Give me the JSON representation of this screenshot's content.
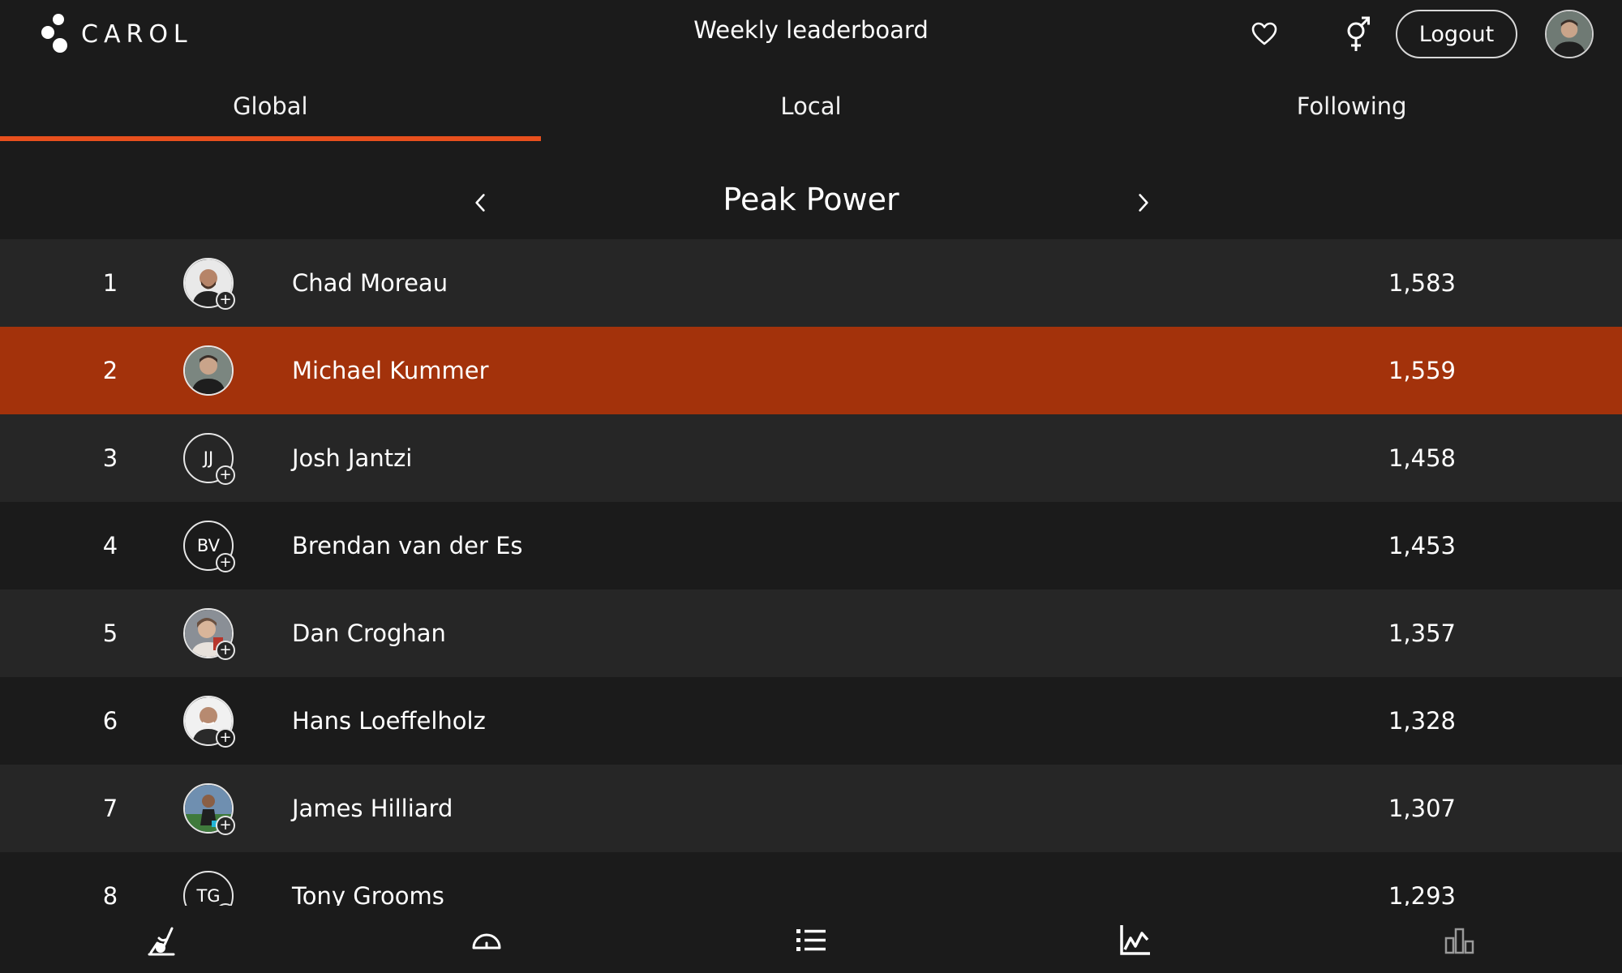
{
  "app": {
    "logo_text": "CAROL",
    "page_title": "Weekly leaderboard",
    "logout_label": "Logout"
  },
  "tabs": [
    {
      "label": "Global",
      "active": true
    },
    {
      "label": "Local",
      "active": false
    },
    {
      "label": "Following",
      "active": false
    }
  ],
  "metric": {
    "title": "Peak Power"
  },
  "leaderboard": [
    {
      "rank": "1",
      "name": "Chad Moreau",
      "score": "1,583",
      "initials": "",
      "has_photo": true,
      "highlighted": false
    },
    {
      "rank": "2",
      "name": "Michael Kummer",
      "score": "1,559",
      "initials": "",
      "has_photo": true,
      "highlighted": true
    },
    {
      "rank": "3",
      "name": "Josh Jantzi",
      "score": "1,458",
      "initials": "JJ",
      "has_photo": false,
      "highlighted": false
    },
    {
      "rank": "4",
      "name": "Brendan van der Es",
      "score": "1,453",
      "initials": "BV",
      "has_photo": false,
      "highlighted": false
    },
    {
      "rank": "5",
      "name": "Dan Croghan",
      "score": "1,357",
      "initials": "",
      "has_photo": true,
      "highlighted": false
    },
    {
      "rank": "6",
      "name": "Hans Loeffelholz",
      "score": "1,328",
      "initials": "",
      "has_photo": true,
      "highlighted": false
    },
    {
      "rank": "7",
      "name": "James Hilliard",
      "score": "1,307",
      "initials": "",
      "has_photo": true,
      "highlighted": false
    },
    {
      "rank": "8",
      "name": "Tony Grooms",
      "score": "1,293",
      "initials": "TG",
      "has_photo": false,
      "highlighted": false
    }
  ],
  "colors": {
    "accent": "#e8501d",
    "highlight_row": "#a3320b",
    "background": "#1b1b1b",
    "row_alt": "#262626"
  },
  "icons": {
    "favorite": "heart-icon",
    "gender": "gender-icon",
    "nav": [
      "bike-icon",
      "gauge-icon",
      "list-icon",
      "line-chart-icon",
      "bar-chart-icon"
    ]
  }
}
